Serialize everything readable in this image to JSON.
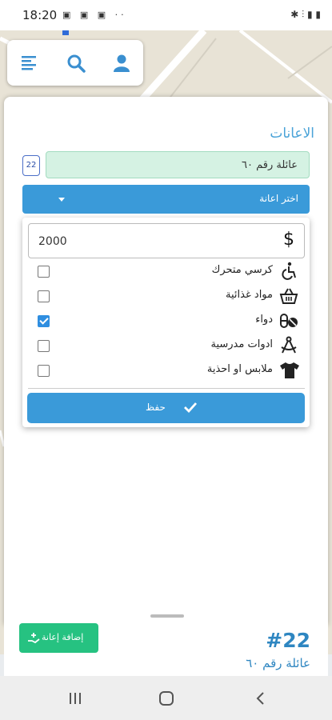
{
  "status_bar": {
    "time": "18:20",
    "icons": "▣ ▣ ▣ ··",
    "right_icons": "✱ ⫶ ▮ ▮"
  },
  "toolbar": {
    "menu_icon": "menu-icon",
    "search_icon": "search-icon",
    "user_icon": "user-icon"
  },
  "panel": {
    "title": "الاعانات",
    "badge": "22",
    "family_value": "عائلة رقم ٦٠",
    "select_label": "اختر اعانة"
  },
  "dropdown": {
    "amount_value": "2000",
    "currency_icon": "$",
    "options": [
      {
        "label": "كرسي متحرك",
        "icon": "wheelchair-icon",
        "checked": false
      },
      {
        "label": "مواد غذائية",
        "icon": "basket-icon",
        "checked": false
      },
      {
        "label": "دواء",
        "icon": "pills-icon",
        "checked": true
      },
      {
        "label": "ادوات مدرسية",
        "icon": "drafting-compass-icon",
        "checked": false
      },
      {
        "label": "ملابس او احذية",
        "icon": "tshirt-icon",
        "checked": false
      }
    ],
    "save_label": "حفظ"
  },
  "sheet": {
    "add_button_label": "إضافة إعانة",
    "family_number": "#22",
    "family_name": "عائلة رقم ٦٠"
  },
  "colors": {
    "primary": "#3a9ad9",
    "success": "#26c281",
    "title_blue": "#4aa3d8",
    "field_green": "#d5f2e3"
  }
}
